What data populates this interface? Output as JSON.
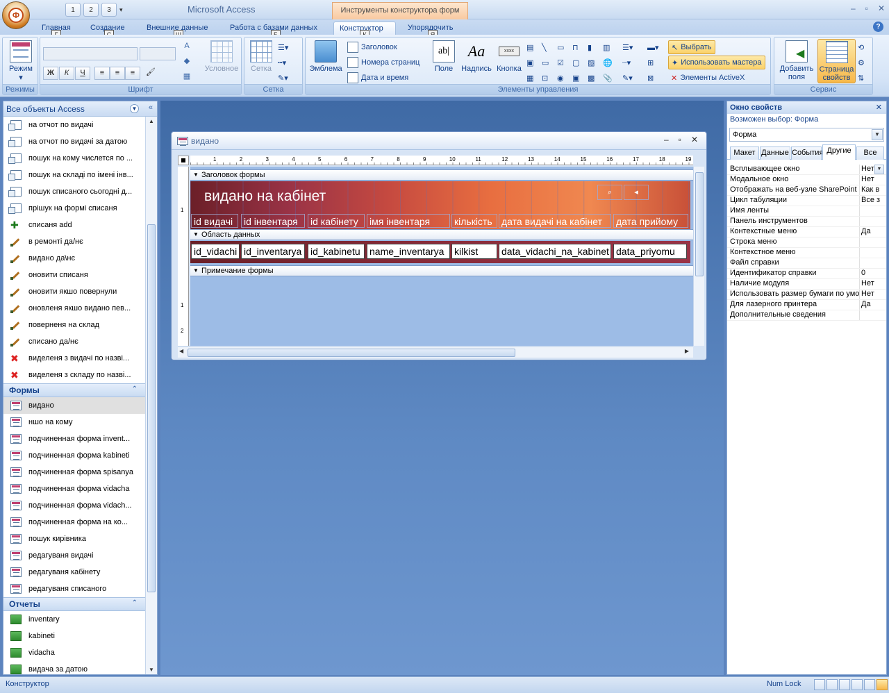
{
  "app": {
    "title": "Microsoft Access",
    "context_tab_title": "Инструменты конструктора форм"
  },
  "qat": {
    "keytips": [
      "1",
      "2",
      "3"
    ]
  },
  "tabs": [
    {
      "label": "Главная",
      "keytip": "Г"
    },
    {
      "label": "Создание",
      "keytip": "С"
    },
    {
      "label": "Внешние данные",
      "keytip": "Ш"
    },
    {
      "label": "Работа с базами данных",
      "keytip": "Б"
    },
    {
      "label": "Конструктор",
      "keytip": "К"
    },
    {
      "label": "Упорядочить",
      "keytip": "Я"
    }
  ],
  "ribbon": {
    "groups": {
      "views": "Режимы",
      "font": "Шрифт",
      "grid": "Сетка",
      "controls": "Элементы управления",
      "tools": "Сервис"
    },
    "mode_label": "Режим",
    "conditional_label": "Условное",
    "grid_label": "Сетка",
    "emblem_label": "Эмблема",
    "header_label": "Заголовок",
    "page_numbers_label": "Номера страниц",
    "date_time_label": "Дата и время",
    "field_label": "Поле",
    "caption_label": "Надпись",
    "button_label": "Кнопка",
    "select_label": "Выбрать",
    "wizard_label": "Использовать мастера",
    "activex_label": "Элементы ActiveX",
    "add_fields_label": "Добавить поля",
    "property_page_label": "Страница свойств",
    "bold": "Ж",
    "italic": "К",
    "underline": "Ч",
    "field_icon_text": "ab|",
    "caption_icon_text": "Aa",
    "button_icon_text": "xxxx"
  },
  "nav": {
    "header": "Все объекты Access",
    "queries": [
      {
        "label": "на отчот по видачі",
        "type": "query"
      },
      {
        "label": "на отчот по видачі за датою",
        "type": "query"
      },
      {
        "label": "пошук на кому числется по ...",
        "type": "query"
      },
      {
        "label": "пошук на складі по імені інв...",
        "type": "query"
      },
      {
        "label": "пошук списаного сьогодні д...",
        "type": "query"
      },
      {
        "label": "прішук на формі списаня",
        "type": "query"
      },
      {
        "label": "списаня add",
        "type": "append"
      },
      {
        "label": "в ремонті да/нє",
        "type": "update"
      },
      {
        "label": "видано да\\нє",
        "type": "update"
      },
      {
        "label": "оновити списаня",
        "type": "update"
      },
      {
        "label": "оновити якшо повернули",
        "type": "update"
      },
      {
        "label": "оновленя якшо видано пев...",
        "type": "update"
      },
      {
        "label": "поверненя на склад",
        "type": "update"
      },
      {
        "label": "списано да/нє",
        "type": "update"
      },
      {
        "label": "виделеня з видачі по назві...",
        "type": "delete"
      },
      {
        "label": "виделеня з складу по назві...",
        "type": "delete"
      }
    ],
    "forms_group": "Формы",
    "forms": [
      "видано",
      "ншо на кому",
      "подчиненная форма invent...",
      "подчиненная форма kabineti",
      "подчиненная форма spisanya",
      "подчиненная форма vidacha",
      "подчиненная форма vidach...",
      "подчиненная форма на ко...",
      "пошук кирівника",
      "редагуваня видачі",
      "редагуваня кабінету",
      "редагуваня списаного"
    ],
    "reports_group": "Отчеты",
    "reports": [
      "inventary",
      "kabineti",
      "vidacha",
      "видача за датою"
    ]
  },
  "form_window": {
    "title": "видано",
    "ruler_numbers": [
      "1",
      "2",
      "3",
      "4",
      "5",
      "6",
      "7",
      "8",
      "9",
      "10",
      "11",
      "12",
      "13",
      "14",
      "15",
      "16",
      "17",
      "18",
      "19"
    ],
    "vruler_numbers": [
      "1",
      "1",
      "2"
    ],
    "section_header": "Заголовок формы",
    "section_detail": "Область данных",
    "section_footer": "Примечание формы",
    "form_title": "видано на кабінет",
    "labels": [
      "id видачі",
      "id інвентаря",
      "id кабінету",
      "імя інвентаря",
      "кількість",
      "дата видачі на кабінет",
      "дата прийому"
    ],
    "fields": [
      "id_vidachi",
      "id_inventarya",
      "id_kabinetu",
      "name_inventarya",
      "kilkist",
      "data_vidachi_na_kabinet",
      "data_priyomu"
    ]
  },
  "props": {
    "header": "Окно свойств",
    "selection_label": "Возможен выбор:  Форма",
    "combo_value": "Форма",
    "tabs": [
      "Макет",
      "Данные",
      "События",
      "Другие",
      "Все"
    ],
    "active_tab": "Другие",
    "rows": [
      {
        "name": "Всплывающее окно",
        "value": "Нет"
      },
      {
        "name": "Модальное окно",
        "value": "Нет"
      },
      {
        "name": "Отображать на веб-узле SharePoint",
        "value": "Как в"
      },
      {
        "name": "Цикл табуляции",
        "value": "Все з"
      },
      {
        "name": "Имя ленты",
        "value": ""
      },
      {
        "name": "Панель инструментов",
        "value": ""
      },
      {
        "name": "Контекстные меню",
        "value": "Да"
      },
      {
        "name": "Строка меню",
        "value": ""
      },
      {
        "name": "Контекстное меню",
        "value": ""
      },
      {
        "name": "Файл справки",
        "value": ""
      },
      {
        "name": "Идентификатор справки",
        "value": "0"
      },
      {
        "name": "Наличие модуля",
        "value": "Нет"
      },
      {
        "name": "Использовать размер бумаги по умолчанию",
        "value": "Нет"
      },
      {
        "name": "Для лазерного принтера",
        "value": "Да"
      },
      {
        "name": "Дополнительные сведения",
        "value": ""
      }
    ]
  },
  "status": {
    "mode": "Конструктор",
    "numlock": "Num Lock"
  },
  "colors": {
    "accent": "#15428b",
    "ribbon_bg": "#d5e4f7",
    "mdi_bg": "#5f8ac4",
    "header_gradient_start": "#6b1f28",
    "header_gradient_end": "#f08850"
  }
}
